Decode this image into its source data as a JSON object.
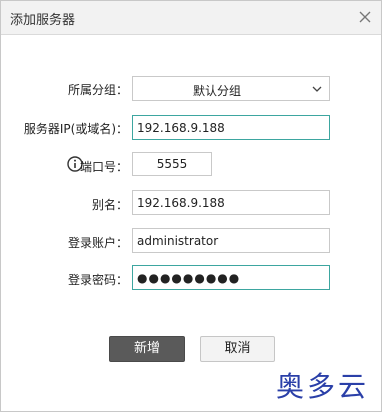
{
  "dialog": {
    "title": "添加服务器"
  },
  "form": {
    "group": {
      "label": "所属分组：",
      "value": "默认分组"
    },
    "server_ip": {
      "label": "服务器IP(或域名)：",
      "value": "192.168.9.188"
    },
    "port": {
      "label": "端口号：",
      "value": "5555"
    },
    "alias": {
      "label": "别名：",
      "value": "192.168.9.188"
    },
    "account": {
      "label": "登录账户：",
      "value": "administrator"
    },
    "password": {
      "label": "登录密码：",
      "value": "●●●●●●●●●"
    }
  },
  "buttons": {
    "add": "新增",
    "cancel": "取消"
  },
  "watermark": "奥多云",
  "colors": {
    "active_border": "#3da6a0",
    "primary_button": "#5a5a5a",
    "watermark": "#2a3fa8"
  }
}
